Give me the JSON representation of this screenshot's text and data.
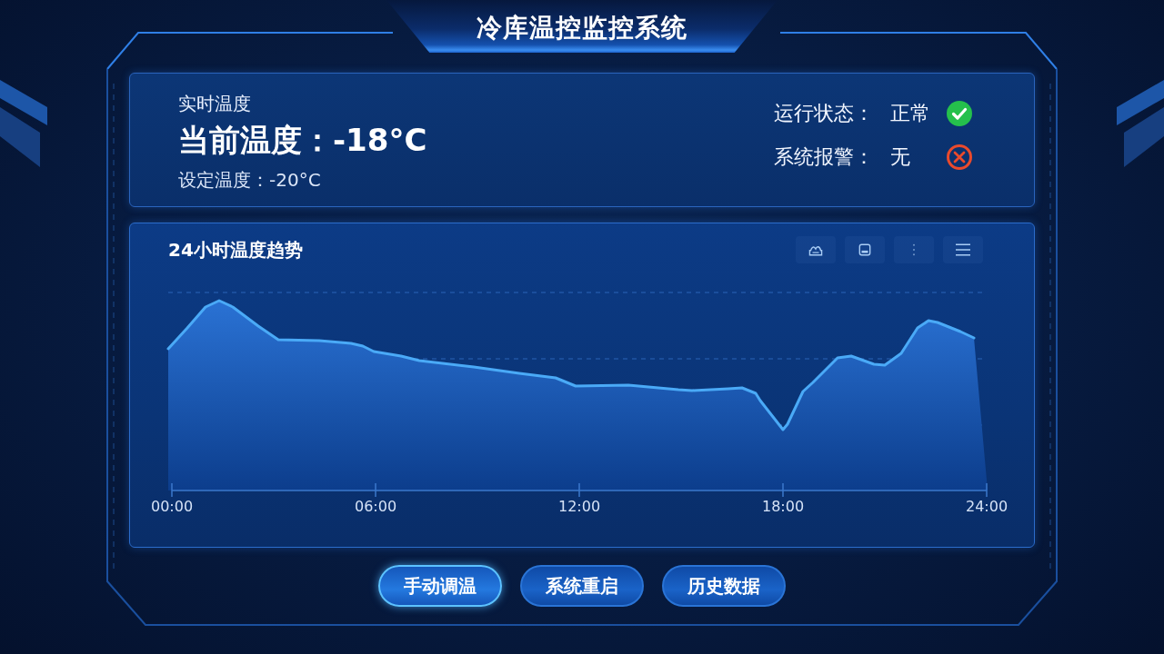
{
  "header": {
    "title": "冷库温控监控系统"
  },
  "realtime_panel": {
    "heading": "实时温度",
    "current": "当前温度：-18°C",
    "setpoint": "设定温度：-20°C"
  },
  "status_items": [
    {
      "kind": "ok",
      "label": "运行状态：",
      "value": "正常"
    },
    {
      "kind": "alarm",
      "label": "系统报警：",
      "value": "无"
    }
  ],
  "trend_chart": {
    "title": "24小时温度趋势",
    "x_labels": [
      "00:00",
      "06:00",
      "12:00",
      "18:00",
      "24:00"
    ]
  },
  "buttons": [
    {
      "label": "手动调温",
      "selected": true
    },
    {
      "label": "系统重启",
      "selected": false
    },
    {
      "label": "历史数据",
      "selected": false
    }
  ]
}
